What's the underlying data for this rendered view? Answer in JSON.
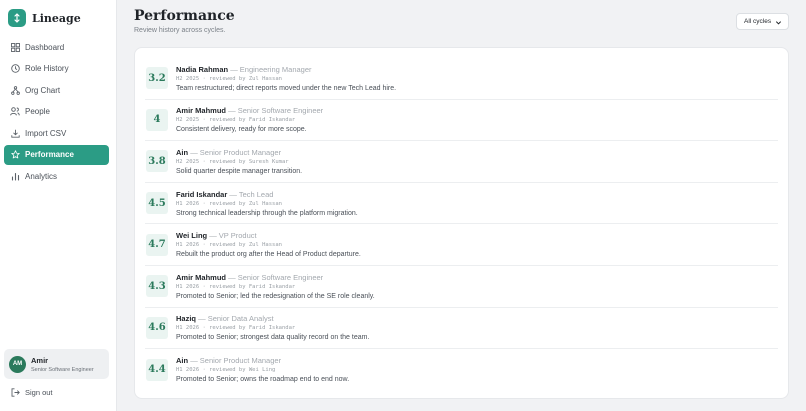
{
  "app": {
    "name": "Lineage",
    "logo_icon": "arrows-up-down-icon",
    "accent": "#2b9c85"
  },
  "sidebar": {
    "items": [
      {
        "label": "Dashboard",
        "icon": "grid-icon",
        "active": false
      },
      {
        "label": "Role History",
        "icon": "clock-icon",
        "active": false
      },
      {
        "label": "Org Chart",
        "icon": "org-chart-icon",
        "active": false
      },
      {
        "label": "People",
        "icon": "people-icon",
        "active": false
      },
      {
        "label": "Import CSV",
        "icon": "download-icon",
        "active": false
      },
      {
        "label": "Performance",
        "icon": "star-icon",
        "active": true
      },
      {
        "label": "Analytics",
        "icon": "bar-chart-icon",
        "active": false
      }
    ],
    "user": {
      "initials": "AM",
      "name": "Amir",
      "role": "Senior Software Engineer"
    },
    "signout": "Sign out"
  },
  "header": {
    "title": "Performance",
    "subtitle": "Review history across cycles.",
    "cycle_filter": "All cycles"
  },
  "reviews": [
    {
      "score": "3.2",
      "name": "Nadia Rahman",
      "role": "— Engineering Manager",
      "meta": "H2 2025 · reviewed by Zul Hassan",
      "note": "Team restructured; direct reports moved under the new Tech Lead hire."
    },
    {
      "score": "4",
      "name": "Amir Mahmud",
      "role": "— Senior Software Engineer",
      "meta": "H2 2025 · reviewed by Farid Iskandar",
      "note": "Consistent delivery, ready for more scope."
    },
    {
      "score": "3.8",
      "name": "Ain",
      "role": "— Senior Product Manager",
      "meta": "H2 2025 · reviewed by Suresh Kumar",
      "note": "Solid quarter despite manager transition."
    },
    {
      "score": "4.5",
      "name": "Farid Iskandar",
      "role": "— Tech Lead",
      "meta": "H1 2026 · reviewed by Zul Hassan",
      "note": "Strong technical leadership through the platform migration."
    },
    {
      "score": "4.7",
      "name": "Wei Ling",
      "role": "— VP Product",
      "meta": "H1 2026 · reviewed by Zul Hassan",
      "note": "Rebuilt the product org after the Head of Product departure."
    },
    {
      "score": "4.3",
      "name": "Amir Mahmud",
      "role": "— Senior Software Engineer",
      "meta": "H1 2026 · reviewed by Farid Iskandar",
      "note": "Promoted to Senior; led the redesignation of the SE role cleanly."
    },
    {
      "score": "4.6",
      "name": "Haziq",
      "role": "— Senior Data Analyst",
      "meta": "H1 2026 · reviewed by Farid Iskandar",
      "note": "Promoted to Senior; strongest data quality record on the team."
    },
    {
      "score": "4.4",
      "name": "Ain",
      "role": "— Senior Product Manager",
      "meta": "H1 2026 · reviewed by Wei Ling",
      "note": "Promoted to Senior; owns the roadmap end to end now."
    }
  ]
}
